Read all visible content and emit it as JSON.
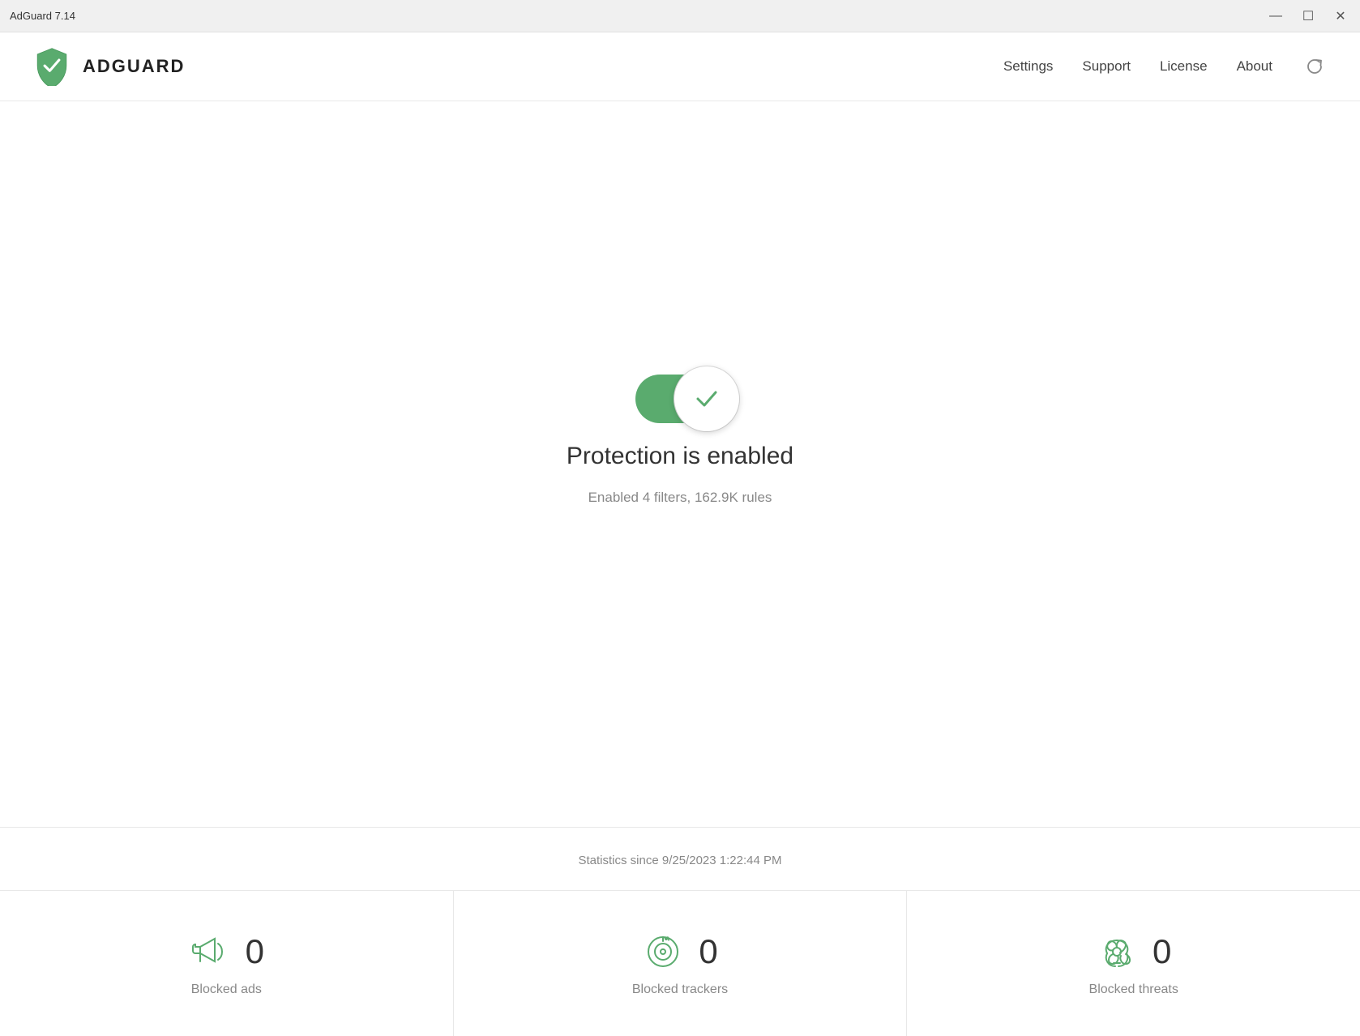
{
  "window": {
    "title": "AdGuard 7.14",
    "controls": {
      "minimize": "—",
      "maximize": "☐",
      "close": "✕"
    }
  },
  "header": {
    "logo_text": "ADGUARD",
    "nav": {
      "settings": "Settings",
      "support": "Support",
      "license": "License",
      "about": "About"
    }
  },
  "protection": {
    "status_title": "Protection is enabled",
    "status_subtitle": "Enabled 4 filters, 162.9K rules",
    "toggle_on": true
  },
  "statistics": {
    "since_label": "Statistics since 9/25/2023 1:22:44 PM",
    "items": [
      {
        "label": "Blocked ads",
        "count": "0"
      },
      {
        "label": "Blocked trackers",
        "count": "0"
      },
      {
        "label": "Blocked threats",
        "count": "0"
      }
    ]
  }
}
